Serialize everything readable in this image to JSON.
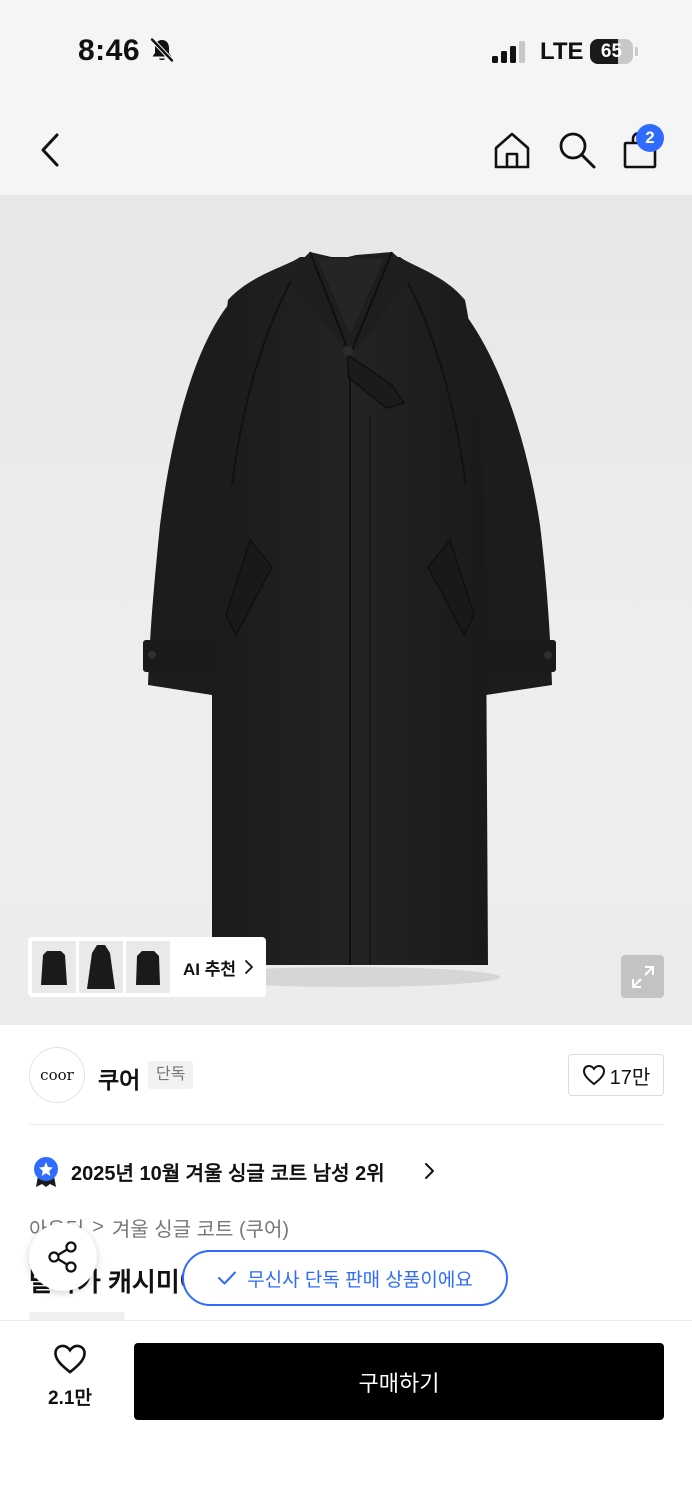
{
  "status_bar": {
    "time": "8:46",
    "network": "LTE",
    "battery_percent": "65",
    "battery_level": 0.65,
    "icons": [
      "bell-slash-icon",
      "signal-icon",
      "battery-icon"
    ]
  },
  "header": {
    "icons": [
      "chevron-left-icon",
      "home-icon",
      "search-icon",
      "shopping-bag-icon"
    ],
    "cart_count": "2",
    "accent_color": "#2f6bff"
  },
  "hero": {
    "ai_recommend_label": "AI 추천",
    "thumbnail_count": 3,
    "icons": [
      "expand-icon",
      "chevron-right-icon"
    ]
  },
  "brand": {
    "logo_text": "coor",
    "name": "쿠어",
    "exclusive_tag": "단독",
    "likes": "17만"
  },
  "ranking": {
    "text": "2025년 10월 겨울 싱글 코트 남성 2위"
  },
  "breadcrumb": {
    "items": [
      "아우터",
      "겨울 싱글 코트 (쿠어)"
    ],
    "separator": ">"
  },
  "product": {
    "title": "발마카 캐시미어 발마칸 코트 (블랙)"
  },
  "toast": {
    "text": "무신사 단독 판매 상품이에요"
  },
  "bottom_bar": {
    "wish_count": "2.1만",
    "buy_label": "구매하기"
  }
}
